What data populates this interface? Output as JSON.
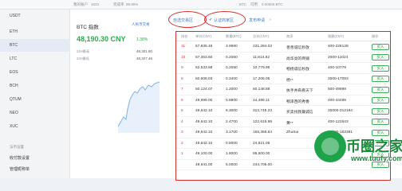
{
  "topbar": {
    "label1": "我的账户",
    "label2": "1023",
    "label3": "完成率",
    "label4": "99.90%",
    "label5": "BTC",
    "label6": "可用",
    "label7": "0.00000 BTC"
  },
  "sidebar": {
    "coins": [
      "USDT",
      "ETH",
      "BTC",
      "LTC",
      "EOS",
      "BCH",
      "QTUM",
      "NEO",
      "XUC"
    ],
    "section_title": "法币设置",
    "links": [
      "收付款设置",
      "管理昵称单"
    ]
  },
  "btc": {
    "title": "BTC 指数",
    "more": "人民币交易",
    "price": "48,190.30 CNY",
    "change": "1.38%",
    "high_label": "24H最高",
    "high_value": "48,301.80",
    "low_label": "24H最低",
    "low_value": "48,327.46"
  },
  "tabs": {
    "tab1": "自选交易区",
    "tab2": "认证商家区",
    "tab3": "发布申请"
  },
  "table": {
    "headers": [
      "排名",
      "单价(CNY)",
      "数量(BTC)",
      "总价(CNY)",
      "商家",
      "限额(CNY)",
      "操作"
    ],
    "buy_label": "买入",
    "rows": [
      {
        "rank": "11",
        "price": "57,835.46",
        "qty": "3.9990",
        "total": "231,284.02",
        "merchant": "善善诚信秒放",
        "limit": "400-228128"
      },
      {
        "rank": "10",
        "price": "57,353.50",
        "qty": "0.2060",
        "total": "11,814.82",
        "merchant": "尚华亮的商铺",
        "limit": "2000-11024"
      },
      {
        "rank": "9",
        "price": "52,533.88",
        "qty": "0.2050",
        "total": "10,779.95",
        "merchant": "畅扬诚信秒放",
        "limit": "400-10779"
      },
      {
        "rank": "8",
        "price": "50,606.03",
        "qty": "0.3400",
        "total": "17,206.05",
        "merchant": "杨**",
        "limit": "2000-17093"
      },
      {
        "rank": "7",
        "price": "50,124.07",
        "qty": "1.2000",
        "total": "60,148.88",
        "merchant": "执手并肩看天下",
        "limit": "500-49999"
      },
      {
        "rank": "6",
        "price": "49,999.00",
        "qty": "0.8900",
        "total": "44,499.11",
        "merchant": "畅泽西的秀香",
        "limit": "400-44499"
      },
      {
        "rank": "5",
        "price": "49,642.10",
        "qty": "6.3000",
        "total": "312,745.23",
        "merchant": "买卖找我最诚信",
        "limit": "20000-312194"
      },
      {
        "rank": "4",
        "price": "49,642.10",
        "qty": "2.4700",
        "total": "122,615.99",
        "merchant": "黄**",
        "limit": "400-122643"
      },
      {
        "rank": "3",
        "price": "49,642.10",
        "qty": "3.1700",
        "total": "155,365.64",
        "merchant": "ZhuSui",
        "limit": "10000-153391"
      },
      {
        "rank": "2",
        "price": "49,642.10",
        "qty": "0.5000",
        "total": "24,821.05",
        "merchant": "",
        "limit": ""
      },
      {
        "rank": "1",
        "price": "49,100.00",
        "qty": "1.8000",
        "total": "88,500.00",
        "merchant": "",
        "limit": ""
      },
      {
        "rank": "",
        "price": "48,941.00",
        "qty": "5.0000",
        "total": "244,705.00",
        "merchant": "",
        "limit": ""
      }
    ]
  },
  "watermark": {
    "title": "币圈之家",
    "url": "www.tuufy.com"
  },
  "colors": {
    "accent_red": "#d62b2b",
    "price_green": "#2faa4f",
    "link_blue": "#3a78c9"
  }
}
